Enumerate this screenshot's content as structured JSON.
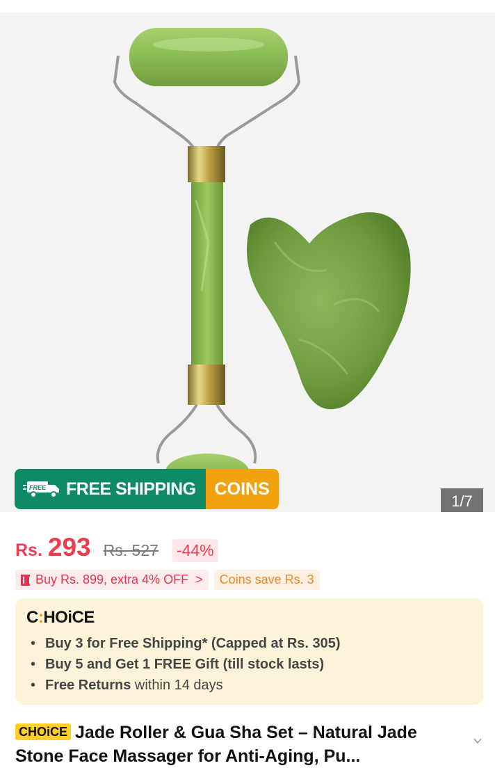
{
  "gallery": {
    "shipping_badge": {
      "free_tag": "FREE",
      "label": "FREE SHIPPING",
      "coins_label": "COINS"
    },
    "image_counter": "1/7"
  },
  "price": {
    "currency": "Rs.",
    "current": "293",
    "original": "Rs. 527",
    "discount": "-44%"
  },
  "promotions": {
    "deal": "Buy Rs. 899, extra 4% OFF",
    "deal_chevron": ">",
    "coins": "Coins save Rs. 3"
  },
  "choice": {
    "logo": "CHOiCE",
    "benefits": [
      {
        "bold": "Buy 3 for  Free Shipping* (Capped at Rs. 305)",
        "rest": ""
      },
      {
        "bold": "Buy 5 and Get 1 FREE Gift (till stock lasts)",
        "rest": ""
      },
      {
        "bold": "Free Returns",
        "rest": " within 14 days"
      }
    ]
  },
  "product": {
    "badge": "CHOiCE",
    "title": "Jade Roller & Gua Sha Set – Natural Jade Stone Face Massager for Anti-Aging, Pu..."
  },
  "colors": {
    "accent_red": "#ef3b4e",
    "shipping_green": "#0e8a66",
    "coins_orange": "#f2a20e",
    "choice_bg": "#fdf3d8",
    "jade_green": "#7fae4a"
  },
  "icons": [
    "truck-icon",
    "coupon-icon",
    "chevron-right-icon",
    "chevron-down-icon"
  ]
}
